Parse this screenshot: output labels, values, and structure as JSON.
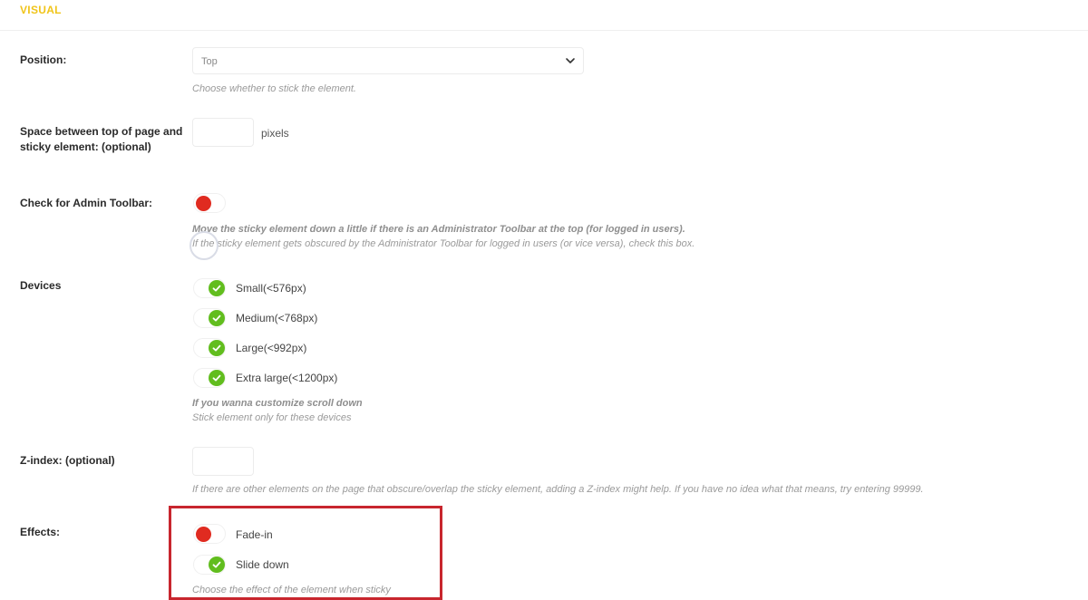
{
  "section": {
    "title": "VISUAL"
  },
  "position": {
    "label": "Position:",
    "selected": "Top",
    "help": "Choose whether to stick the element."
  },
  "space": {
    "label_line1": "Space between top of page and",
    "label_line2": "sticky element: (optional)",
    "value": "",
    "unit": "pixels"
  },
  "admin_toolbar": {
    "label": "Check for Admin Toolbar:",
    "checked": false,
    "help_strong": "Move the sticky element down a little if there is an Administrator Toolbar at the top (for logged in users).",
    "help": "If the sticky element gets obscured by the Administrator Toolbar for logged in users (or vice versa), check this box."
  },
  "devices": {
    "label": "Devices",
    "options": [
      {
        "label": "Small(<576px)",
        "checked": true
      },
      {
        "label": "Medium(<768px)",
        "checked": true
      },
      {
        "label": "Large(<992px)",
        "checked": true
      },
      {
        "label": "Extra large(<1200px)",
        "checked": true
      }
    ],
    "help_strong": "If you wanna customize scroll down",
    "help": "Stick element only for these devices"
  },
  "zindex": {
    "label": "Z-index: (optional)",
    "value": "",
    "help": "If there are other elements on the page that obscure/overlap the sticky element, adding a Z-index might help. If you have no idea what that means, try entering 99999."
  },
  "effects": {
    "label": "Effects:",
    "options": [
      {
        "label": "Fade-in",
        "checked": false
      },
      {
        "label": "Slide down",
        "checked": true
      }
    ],
    "help": "Choose the effect of the element when sticky"
  },
  "colors": {
    "accent_title": "#f0c419",
    "toggle_off": "#e02b20",
    "toggle_on": "#61bd1e",
    "highlight": "#c8262e"
  }
}
